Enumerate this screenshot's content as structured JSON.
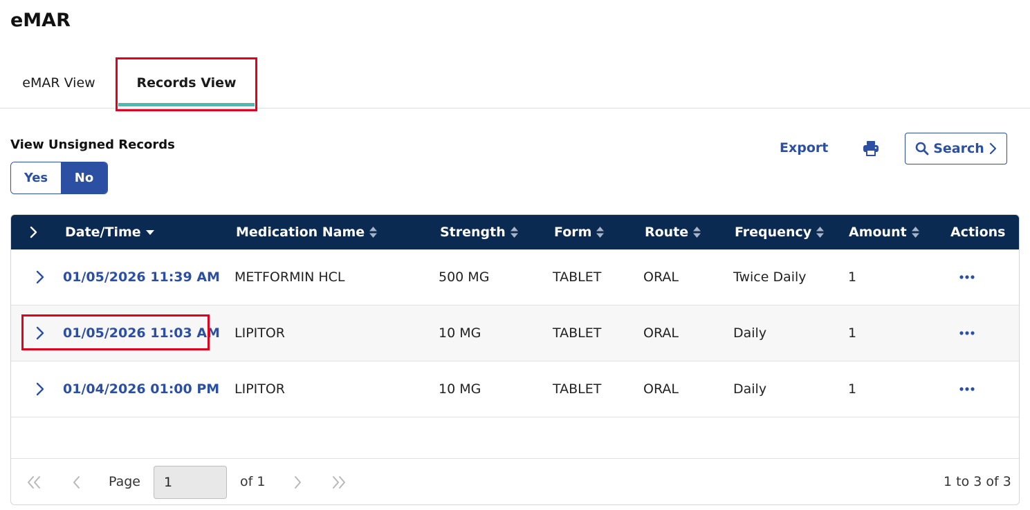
{
  "app": {
    "title": "eMAR"
  },
  "tabs": [
    {
      "label": "eMAR View",
      "active": false
    },
    {
      "label": "Records View",
      "active": true
    }
  ],
  "filter": {
    "label": "View Unsigned Records",
    "options": [
      "Yes",
      "No"
    ],
    "selected": "No"
  },
  "toolbar": {
    "export_label": "Export",
    "print_icon": "printer-icon",
    "search_label": "Search"
  },
  "table": {
    "columns": [
      "Date/Time",
      "Medication Name",
      "Strength",
      "Form",
      "Route",
      "Frequency",
      "Amount",
      "Actions"
    ],
    "sorted_column": "Date/Time",
    "sort_direction": "descending",
    "rows": [
      {
        "datetime": "01/05/2026 11:39 AM",
        "medication": "METFORMIN HCL",
        "strength": "500 MG",
        "form": "TABLET",
        "route": "ORAL",
        "frequency": "Twice Daily",
        "amount": "1"
      },
      {
        "datetime": "01/05/2026 11:03 AM",
        "medication": "LIPITOR",
        "strength": "10 MG",
        "form": "TABLET",
        "route": "ORAL",
        "frequency": "Daily",
        "amount": "1"
      },
      {
        "datetime": "01/04/2026 01:00 PM",
        "medication": "LIPITOR",
        "strength": "10 MG",
        "form": "TABLET",
        "route": "ORAL",
        "frequency": "Daily",
        "amount": "1"
      }
    ]
  },
  "pagination": {
    "page_label": "Page",
    "current_page": "1",
    "of_label": "of 1",
    "summary": "1 to 3 of 3"
  },
  "colors": {
    "header_bg": "#0b2a52",
    "accent_blue": "#2b4fa2",
    "tab_underline": "#4fb8b0",
    "highlight_red": "#e3001b"
  }
}
